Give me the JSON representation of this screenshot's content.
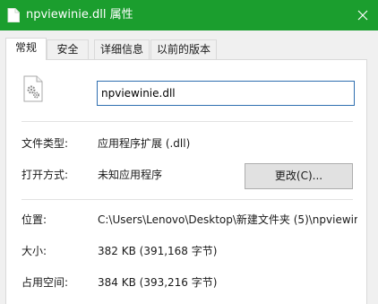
{
  "window": {
    "title": "npviewinie.dll 属性",
    "accent_color": "#1b9e2e"
  },
  "tabs": [
    {
      "label": "常规",
      "active": true
    },
    {
      "label": "安全",
      "active": false
    },
    {
      "label": "详细信息",
      "active": false
    },
    {
      "label": "以前的版本",
      "active": false
    }
  ],
  "general": {
    "file_icon": "dll-file-gear-icon",
    "file_name": "npviewinie.dll",
    "type_label": "文件类型:",
    "type_value": "应用程序扩展 (.dll)",
    "opens_with_label": "打开方式:",
    "opens_with_value": "未知应用程序",
    "change_button": "更改(C)...",
    "location_label": "位置:",
    "location_value": "C:\\Users\\Lenovo\\Desktop\\新建文件夹 (5)\\npviewir",
    "size_label": "大小:",
    "size_value": "382 KB (391,168 字节)",
    "size_on_disk_label": "占用空间:",
    "size_on_disk_value": "384 KB (393,216 字节)"
  }
}
